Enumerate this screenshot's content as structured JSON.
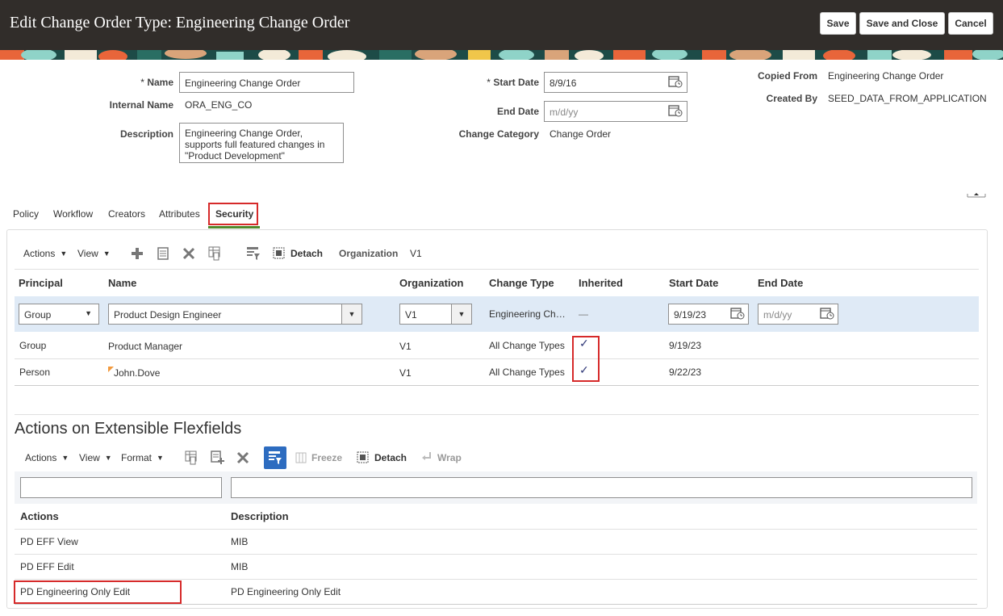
{
  "header": {
    "title": "Edit Change Order Type: Engineering Change Order",
    "save_label": "Save",
    "save_close_label": "Save and Close",
    "cancel_label": "Cancel"
  },
  "form": {
    "name_label": "Name",
    "name_value": "Engineering Change Order",
    "internal_name_label": "Internal Name",
    "internal_name_value": "ORA_ENG_CO",
    "description_label": "Description",
    "description_value": "Engineering Change Order, supports full featured changes in \"Product Development\"",
    "start_date_label": "Start Date",
    "start_date_value": "8/9/16",
    "end_date_label": "End Date",
    "end_date_placeholder": "m/d/yy",
    "change_category_label": "Change Category",
    "change_category_value": "Change Order",
    "copied_from_label": "Copied From",
    "copied_from_value": "Engineering Change Order",
    "created_by_label": "Created By",
    "created_by_value": "SEED_DATA_FROM_APPLICATION",
    "required_mark": "*"
  },
  "tabs": [
    "Policy",
    "Workflow",
    "Creators",
    "Attributes",
    "Security"
  ],
  "active_tab": "Security",
  "security": {
    "toolbar": {
      "actions": "Actions",
      "view": "View",
      "detach": "Detach",
      "org_label": "Organization",
      "org_value": "V1"
    },
    "columns": [
      "Principal",
      "Name",
      "Organization",
      "Change Type",
      "Inherited",
      "Start Date",
      "End Date"
    ],
    "edit_row": {
      "principal": "Group",
      "name": "Product Design Engineer",
      "organization": "V1",
      "change_type": "Engineering Ch…",
      "inherited": "—",
      "start_date": "9/19/23",
      "end_date_placeholder": "m/d/yy"
    },
    "rows": [
      {
        "principal": "Group",
        "name": "Product Manager",
        "organization": "V1",
        "change_type": "All Change Types",
        "inherited": "✓",
        "start_date": "9/19/23"
      },
      {
        "principal": "Person",
        "name": "John.Dove",
        "organization": "V1",
        "change_type": "All Change Types",
        "inherited": "✓",
        "start_date": "9/22/23"
      }
    ]
  },
  "eff": {
    "title": "Actions on Extensible Flexfields",
    "toolbar": {
      "actions": "Actions",
      "view": "View",
      "format": "Format",
      "freeze": "Freeze",
      "detach": "Detach",
      "wrap": "Wrap"
    },
    "columns": [
      "Actions",
      "Description"
    ],
    "rows": [
      {
        "action": "PD EFF View",
        "description": "MIB"
      },
      {
        "action": "PD EFF Edit",
        "description": "MIB"
      },
      {
        "action": "PD Engineering Only Edit",
        "description": "PD Engineering Only Edit"
      }
    ]
  },
  "colors": {
    "header_bg": "#312d2a",
    "highlight_red": "#d62a2a",
    "selected_row": "#dfeaf6",
    "tab_underline": "#4f8a2c",
    "filter_button": "#2d6cc0"
  }
}
